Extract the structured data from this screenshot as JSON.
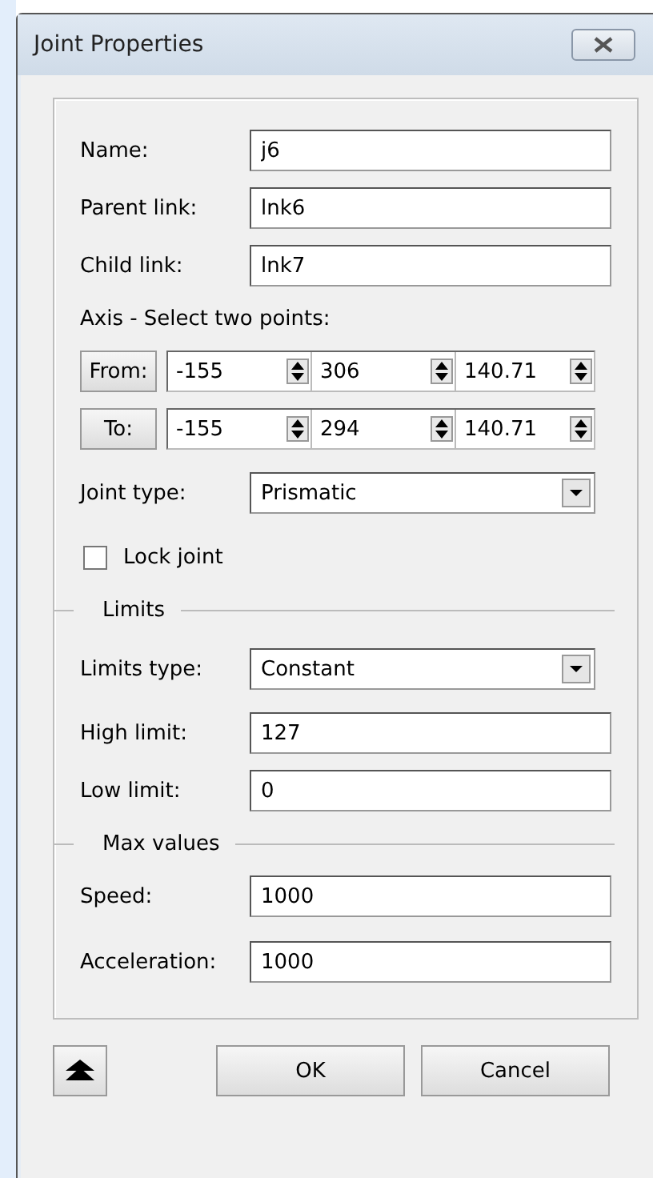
{
  "window": {
    "title": "Joint Properties"
  },
  "rows": [
    {
      "kind": "text",
      "label": "Name:",
      "value": "j6"
    },
    {
      "kind": "text",
      "label": "Parent link:",
      "value": "lnk6"
    },
    {
      "kind": "text",
      "label": "Child link:",
      "value": "lnk7"
    },
    {
      "kind": "heading",
      "label": "Axis - Select two points:"
    },
    {
      "kind": "point",
      "label": "From:",
      "values": [
        "-155",
        "306",
        "140.71"
      ]
    },
    {
      "kind": "point",
      "label": "To:",
      "values": [
        "-155",
        "294",
        "140.71"
      ]
    },
    {
      "kind": "select",
      "label": "Joint type:",
      "value": "Prismatic"
    },
    {
      "kind": "checkbox",
      "label": "Lock joint",
      "checked": false
    },
    {
      "kind": "section",
      "label": "Limits"
    },
    {
      "kind": "select",
      "label": "Limits type:",
      "value": "Constant"
    },
    {
      "kind": "text",
      "label": "High limit:",
      "value": "127"
    },
    {
      "kind": "text",
      "label": "Low limit:",
      "value": "0"
    },
    {
      "kind": "section",
      "label": "Max values"
    },
    {
      "kind": "text",
      "label": "Speed:",
      "value": "1000"
    },
    {
      "kind": "text",
      "label": "Acceleration:",
      "value": "1000"
    }
  ],
  "buttons": [
    "OK",
    "Cancel"
  ]
}
